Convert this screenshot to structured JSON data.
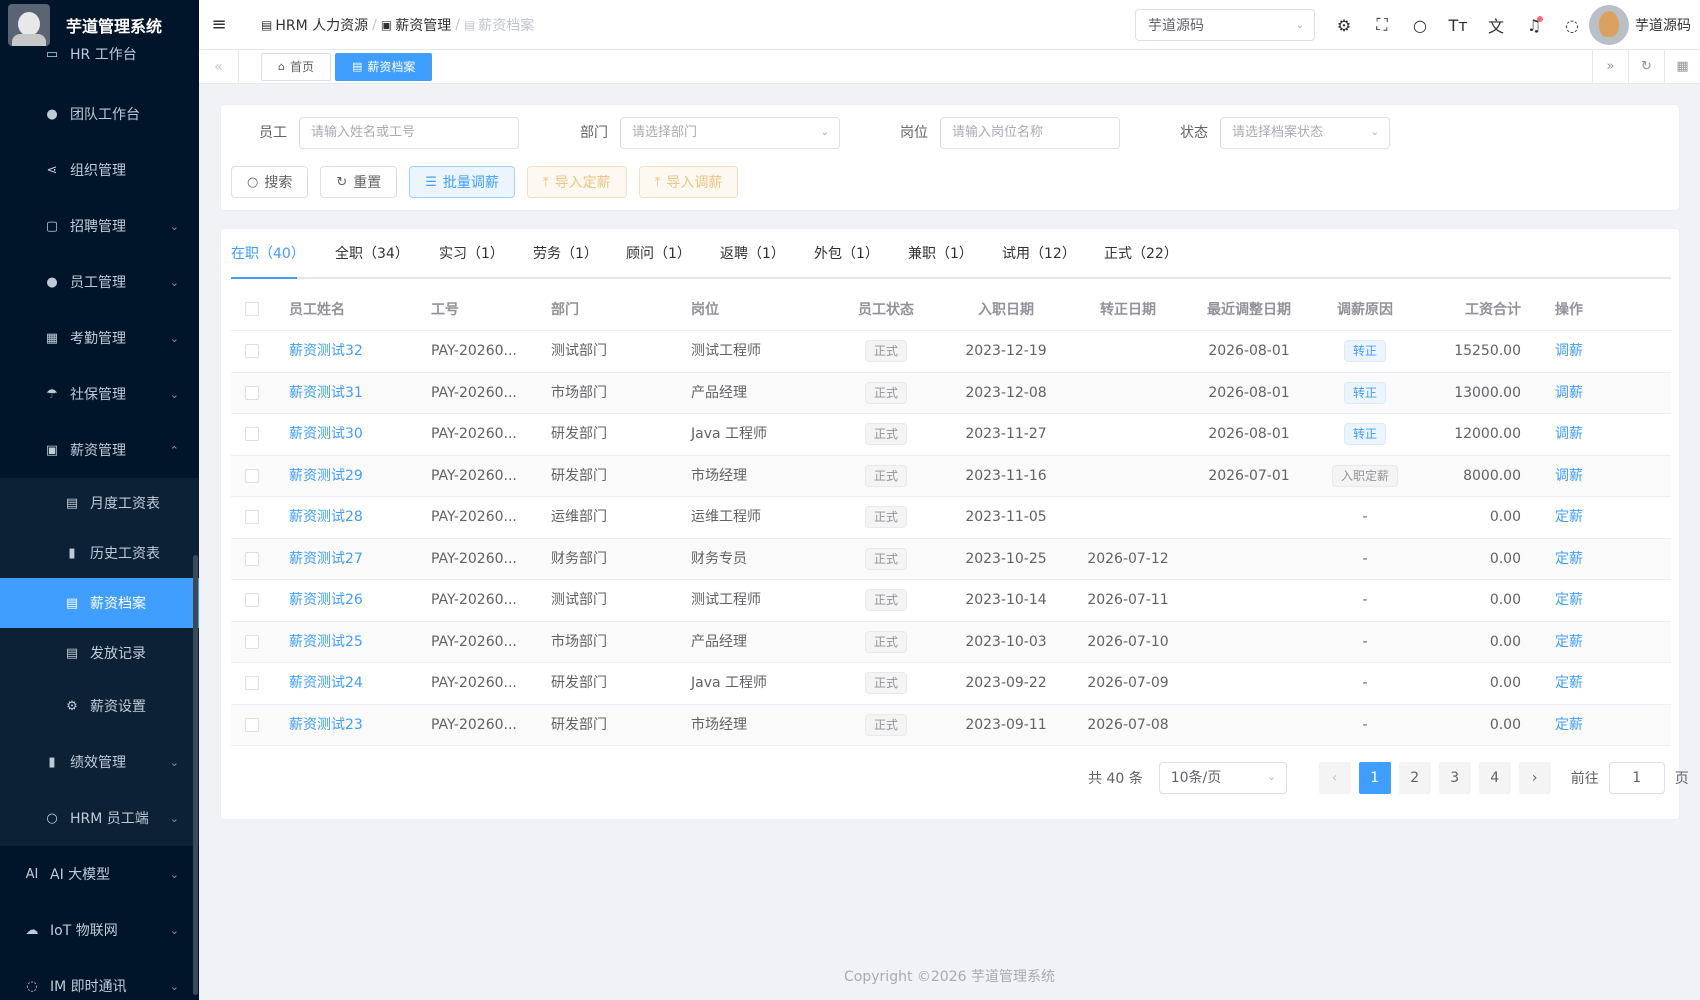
{
  "app": {
    "title": "芋道管理系统"
  },
  "sidebar": {
    "items": [
      {
        "label": "HR 工作台",
        "icon": "monitor-icon",
        "glyph": "▭",
        "arrow": ""
      },
      {
        "label": "团队工作台",
        "icon": "user-icon",
        "glyph": "●",
        "arrow": ""
      },
      {
        "label": "组织管理",
        "icon": "share-icon",
        "glyph": "⋖",
        "arrow": ""
      },
      {
        "label": "招聘管理",
        "icon": "briefcase-icon",
        "glyph": "▢",
        "arrow": "⌄"
      },
      {
        "label": "员工管理",
        "icon": "user-icon",
        "glyph": "●",
        "arrow": "⌄"
      },
      {
        "label": "考勤管理",
        "icon": "calendar-icon",
        "glyph": "▦",
        "arrow": "⌄"
      },
      {
        "label": "社保管理",
        "icon": "umbrella-icon",
        "glyph": "☂",
        "arrow": "⌄"
      },
      {
        "label": "薪资管理",
        "icon": "wallet-icon",
        "glyph": "▣",
        "arrow": "⌃"
      }
    ],
    "sub_items": [
      {
        "label": "月度工资表",
        "icon": "document-icon",
        "glyph": "▤"
      },
      {
        "label": "历史工资表",
        "icon": "bar-chart-icon",
        "glyph": "▮"
      },
      {
        "label": "薪资档案",
        "icon": "folder-icon",
        "glyph": "▤"
      },
      {
        "label": "发放记录",
        "icon": "list-icon",
        "glyph": "▤"
      },
      {
        "label": "薪资设置",
        "icon": "gear-icon",
        "glyph": "⚙"
      }
    ],
    "bottom_items": [
      {
        "label": "绩效管理",
        "icon": "bar-chart-icon",
        "glyph": "▮",
        "arrow": "⌄"
      },
      {
        "label": "HRM 员工端",
        "icon": "user-outline-icon",
        "glyph": "○",
        "arrow": "⌄"
      }
    ],
    "top_items": [
      {
        "label": "AI 大模型",
        "icon": "ai-icon",
        "glyph": "AI",
        "arrow": "⌄"
      },
      {
        "label": "IoT 物联网",
        "icon": "iot-icon",
        "glyph": "☁",
        "arrow": "⌄"
      },
      {
        "label": "IM 即时通讯",
        "icon": "chat-icon",
        "glyph": "◌",
        "arrow": "⌄"
      }
    ]
  },
  "header": {
    "breadcrumb": [
      "HRM 人力资源",
      "薪资管理",
      "薪资档案"
    ],
    "tenant": "芋道源码",
    "user_name": "芋道源码"
  },
  "tabs": {
    "home": "首页",
    "current": "薪资档案"
  },
  "search": {
    "employee_label": "员工",
    "employee_placeholder": "请输入姓名或工号",
    "dept_label": "部门",
    "dept_placeholder": "请选择部门",
    "post_label": "岗位",
    "post_placeholder": "请输入岗位名称",
    "status_label": "状态",
    "status_placeholder": "请选择档案状态",
    "buttons": {
      "search": "搜索",
      "reset": "重置",
      "batch": "批量调薪",
      "import_set": "导入定薪",
      "import_adjust": "导入调薪"
    }
  },
  "status_tabs": [
    "在职（40）",
    "全职（34）",
    "实习（1）",
    "劳务（1）",
    "顾问（1）",
    "返聘（1）",
    "外包（1）",
    "兼职（1）",
    "试用（12）",
    "正式（22）"
  ],
  "table": {
    "headers": [
      "员工姓名",
      "工号",
      "部门",
      "岗位",
      "员工状态",
      "入职日期",
      "转正日期",
      "最近调整日期",
      "调薪原因",
      "工资合计",
      "操作"
    ],
    "rows": [
      {
        "name": "薪资测试32",
        "no": "PAY-20260...",
        "dept": "测试部门",
        "post": "测试工程师",
        "status": "正式",
        "hire": "2023-12-19",
        "regular": "",
        "adjust": "2026-08-01",
        "reason": "转正",
        "reason_type": "primary",
        "total": "15250.00",
        "op": "调薪"
      },
      {
        "name": "薪资测试31",
        "no": "PAY-20260...",
        "dept": "市场部门",
        "post": "产品经理",
        "status": "正式",
        "hire": "2023-12-08",
        "regular": "",
        "adjust": "2026-08-01",
        "reason": "转正",
        "reason_type": "primary",
        "total": "13000.00",
        "op": "调薪"
      },
      {
        "name": "薪资测试30",
        "no": "PAY-20260...",
        "dept": "研发部门",
        "post": "Java 工程师",
        "status": "正式",
        "hire": "2023-11-27",
        "regular": "",
        "adjust": "2026-08-01",
        "reason": "转正",
        "reason_type": "primary",
        "total": "12000.00",
        "op": "调薪"
      },
      {
        "name": "薪资测试29",
        "no": "PAY-20260...",
        "dept": "研发部门",
        "post": "市场经理",
        "status": "正式",
        "hire": "2023-11-16",
        "regular": "",
        "adjust": "2026-07-01",
        "reason": "入职定薪",
        "reason_type": "info",
        "total": "8000.00",
        "op": "调薪"
      },
      {
        "name": "薪资测试28",
        "no": "PAY-20260...",
        "dept": "运维部门",
        "post": "运维工程师",
        "status": "正式",
        "hire": "2023-11-05",
        "regular": "",
        "adjust": "",
        "reason": "-",
        "reason_type": "",
        "total": "0.00",
        "op": "定薪"
      },
      {
        "name": "薪资测试27",
        "no": "PAY-20260...",
        "dept": "财务部门",
        "post": "财务专员",
        "status": "正式",
        "hire": "2023-10-25",
        "regular": "2026-07-12",
        "adjust": "",
        "reason": "-",
        "reason_type": "",
        "total": "0.00",
        "op": "定薪"
      },
      {
        "name": "薪资测试26",
        "no": "PAY-20260...",
        "dept": "测试部门",
        "post": "测试工程师",
        "status": "正式",
        "hire": "2023-10-14",
        "regular": "2026-07-11",
        "adjust": "",
        "reason": "-",
        "reason_type": "",
        "total": "0.00",
        "op": "定薪"
      },
      {
        "name": "薪资测试25",
        "no": "PAY-20260...",
        "dept": "市场部门",
        "post": "产品经理",
        "status": "正式",
        "hire": "2023-10-03",
        "regular": "2026-07-10",
        "adjust": "",
        "reason": "-",
        "reason_type": "",
        "total": "0.00",
        "op": "定薪"
      },
      {
        "name": "薪资测试24",
        "no": "PAY-20260...",
        "dept": "研发部门",
        "post": "Java 工程师",
        "status": "正式",
        "hire": "2023-09-22",
        "regular": "2026-07-09",
        "adjust": "",
        "reason": "-",
        "reason_type": "",
        "total": "0.00",
        "op": "定薪"
      },
      {
        "name": "薪资测试23",
        "no": "PAY-20260...",
        "dept": "研发部门",
        "post": "市场经理",
        "status": "正式",
        "hire": "2023-09-11",
        "regular": "2026-07-08",
        "adjust": "",
        "reason": "-",
        "reason_type": "",
        "total": "0.00",
        "op": "定薪"
      }
    ]
  },
  "pagination": {
    "total": "共 40 条",
    "page_size": "10条/页",
    "pages": [
      "1",
      "2",
      "3",
      "4"
    ],
    "current": "1",
    "goto_label": "前往",
    "goto_value": "1",
    "page_unit": "页"
  },
  "footer": "Copyright ©2026 芋道管理系统",
  "colors": {
    "primary": "#409eff",
    "sidebar_bg": "#001529",
    "warning": "#e6a23c"
  }
}
